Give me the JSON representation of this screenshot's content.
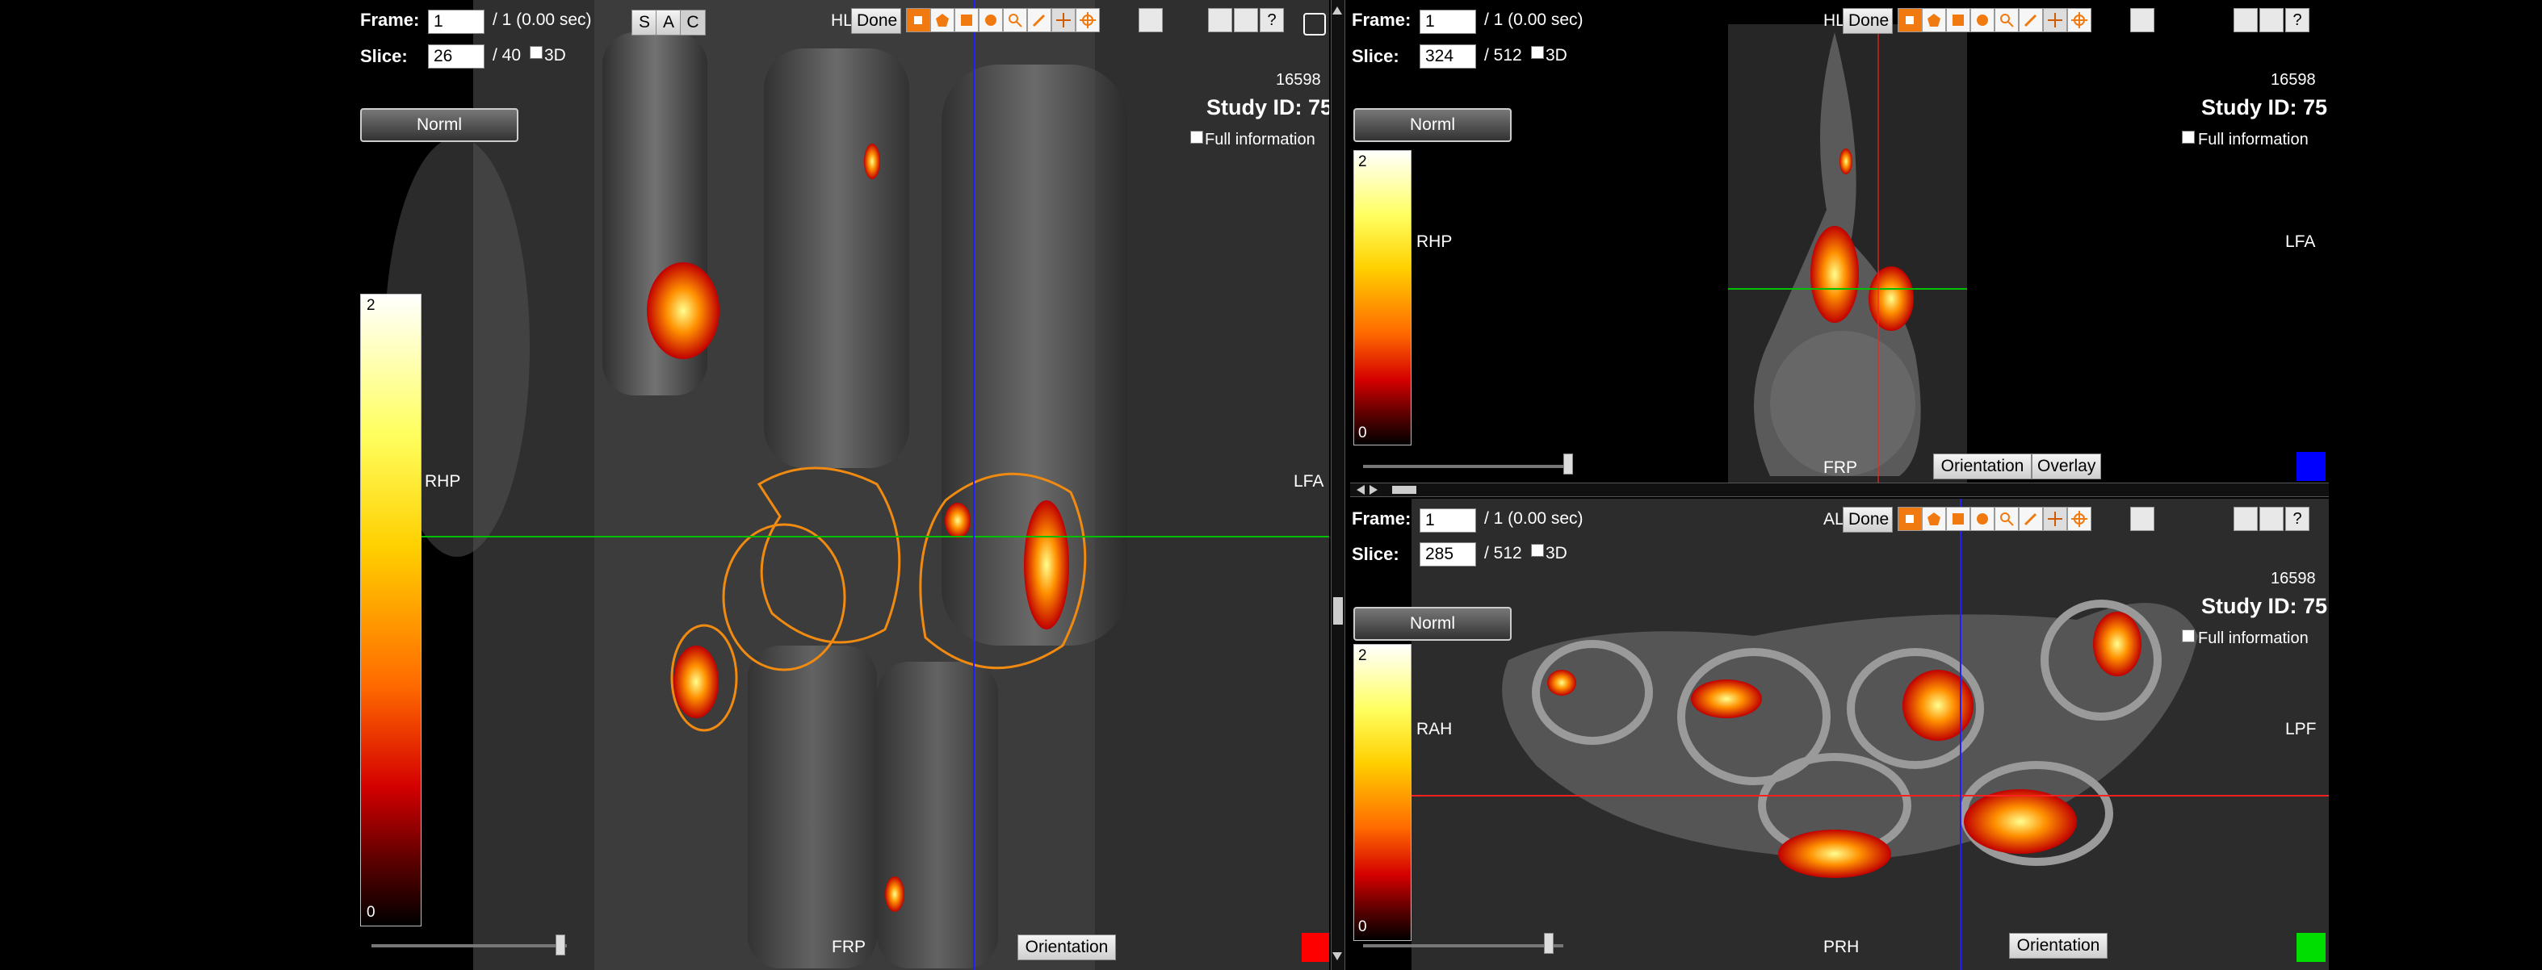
{
  "labels": {
    "frame": "Frame:",
    "slice": "Slice:",
    "threed": "3D",
    "done": "Done",
    "norml": "Norml",
    "full_info": "Full information",
    "orientation": "Orientation",
    "overlay": "Overlay"
  },
  "panes": {
    "coronal": {
      "frame_value": "1",
      "frame_total": "/ 1 (0.00 sec)",
      "slice_value": "26",
      "slice_total": "/ 40",
      "view_buttons": [
        "S",
        "A",
        "C"
      ],
      "orient_prefix": "HL",
      "study_num": "16598",
      "study_id": "Study ID: 75",
      "colorbar_max": "2",
      "colorbar_min": "0",
      "left_label": "RHP",
      "right_label": "LFA",
      "bottom_label": "FRP",
      "marker_color": "#ff0000"
    },
    "sagittal": {
      "frame_value": "1",
      "frame_total": "/ 1 (0.00 sec)",
      "slice_value": "324",
      "slice_total": "/ 512",
      "orient_prefix": "HL",
      "study_num": "16598",
      "study_id": "Study ID: 75",
      "colorbar_max": "2",
      "colorbar_min": "0",
      "left_label": "RHP",
      "right_label": "LFA",
      "bottom_label": "FRP",
      "marker_color": "#0000ff"
    },
    "axial": {
      "frame_value": "1",
      "frame_total": "/ 1 (0.00 sec)",
      "slice_value": "285",
      "slice_total": "/ 512",
      "orient_prefix": "AL",
      "study_num": "16598",
      "study_id": "Study ID: 75",
      "colorbar_max": "2",
      "colorbar_min": "0",
      "left_label": "RAH",
      "right_label": "LPF",
      "bottom_label": "PRH",
      "marker_color": "#00dd00"
    }
  },
  "colors": {
    "accent": "#f07a10",
    "crosshair_h": "#00c000",
    "crosshair_v": "#2020ff",
    "crosshair_r": "#ff0000"
  }
}
